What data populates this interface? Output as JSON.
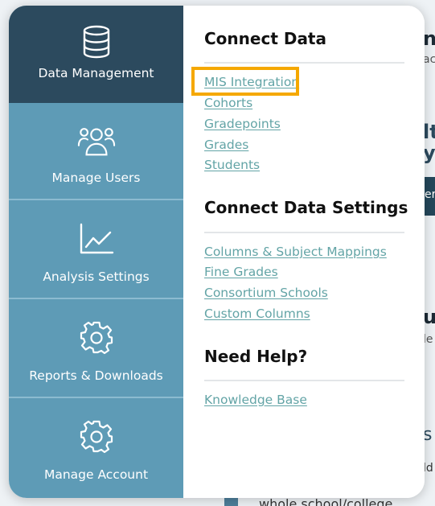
{
  "nav": {
    "items": [
      {
        "label": "Data Management",
        "icon": "database-icon",
        "active": true
      },
      {
        "label": "Manage Users",
        "icon": "users-icon",
        "active": false
      },
      {
        "label": "Analysis Settings",
        "icon": "line-chart-icon",
        "active": false
      },
      {
        "label": "Reports & Downloads",
        "icon": "gear-icon",
        "active": false
      },
      {
        "label": "Manage Account",
        "icon": "gear-icon",
        "active": false
      }
    ]
  },
  "menu": {
    "connect_data": {
      "title": "Connect Data",
      "links": [
        "MIS Integration",
        "Cohorts",
        "Gradepoints",
        "Grades",
        "Students"
      ]
    },
    "connect_data_settings": {
      "title": "Connect Data Settings",
      "links": [
        "Columns & Subject Mappings",
        "Fine Grades",
        "Consortium Schools",
        "Custom Columns"
      ]
    },
    "need_help": {
      "title": "Need Help?",
      "links": [
        "Knowledge Base"
      ]
    }
  },
  "background": {
    "bottom_text": "whole school/college"
  },
  "colors": {
    "nav_bg": "#5e9bb6",
    "nav_active_bg": "#2c4a5e",
    "link": "#63a4a6",
    "highlight": "#f5a800"
  }
}
